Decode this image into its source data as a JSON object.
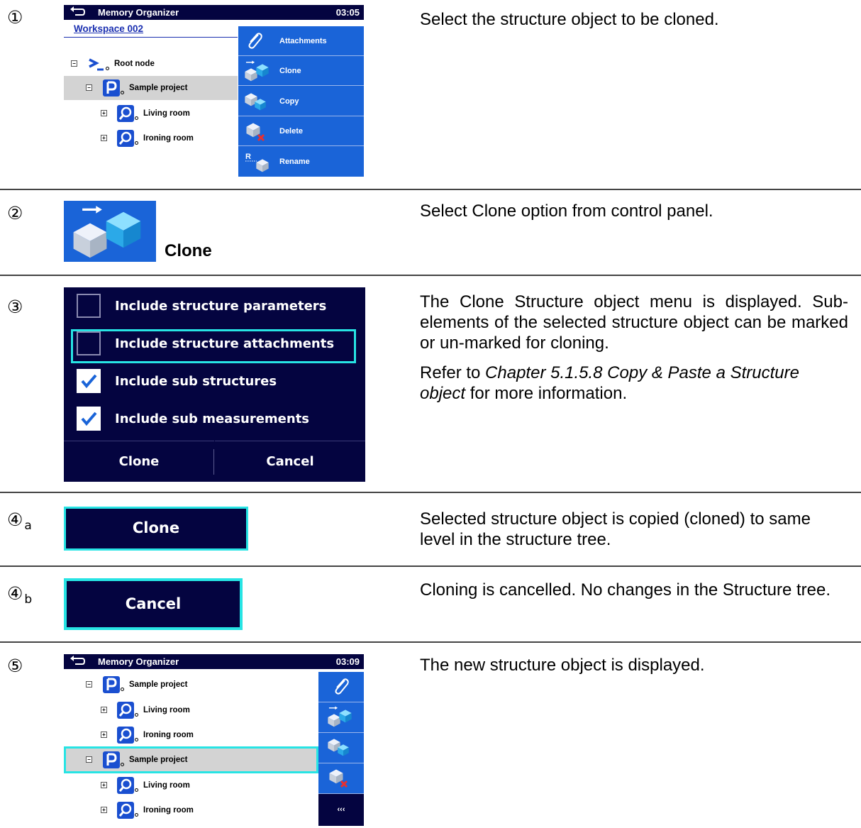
{
  "steps": [
    {
      "num": "①",
      "sub": ""
    },
    {
      "num": "②",
      "sub": ""
    },
    {
      "num": "③",
      "sub": ""
    },
    {
      "num": "④",
      "sub": "a"
    },
    {
      "num": "④",
      "sub": "b"
    },
    {
      "num": "⑤",
      "sub": ""
    }
  ],
  "descriptions": {
    "s1": "Select the structure object to be cloned.",
    "s2": "Select Clone option from control panel.",
    "s3_p1": "The Clone Structure object menu is displayed. Sub-elements of the selected structure object can be marked or un-marked for cloning.",
    "s3_p2_pre": "Refer to ",
    "s3_p2_ital": "Chapter 5.1.5.8 Copy & Paste a Structure object",
    "s3_p2_post": " for more information.",
    "s4a": "Selected structure object is copied (cloned) to same level in the structure tree.",
    "s4b": "Cloning is cancelled. No changes in the Structure tree.",
    "s5": "The new structure object is displayed."
  },
  "screen1": {
    "title": "Memory Organizer",
    "time": "03:05",
    "workspace": "Workspace 002",
    "tree": [
      {
        "label": "Root node",
        "expander": "−"
      },
      {
        "label": "Sample project",
        "expander": "−"
      },
      {
        "label": "Living room",
        "expander": "+"
      },
      {
        "label": "Ironing room",
        "expander": "+"
      }
    ],
    "panel": [
      "Attachments",
      "Clone",
      "Copy",
      "Delete",
      "Rename"
    ]
  },
  "clone_icon_label": "Clone",
  "dialog": {
    "options": [
      {
        "label": "Include structure parameters",
        "checked": false
      },
      {
        "label": "Include structure attachments",
        "checked": false
      },
      {
        "label": "Include sub structures",
        "checked": true
      },
      {
        "label": "Include sub measurements",
        "checked": true
      }
    ],
    "clone": "Clone",
    "cancel": "Cancel"
  },
  "btn_clone": "Clone",
  "btn_cancel": "Cancel",
  "screen5": {
    "title": "Memory Organizer",
    "time": "03:09",
    "tree": [
      {
        "label": "Sample project",
        "expander": "−"
      },
      {
        "label": "Living room",
        "expander": "+"
      },
      {
        "label": "Ironing room",
        "expander": "+"
      },
      {
        "label": "Sample project",
        "expander": "−"
      },
      {
        "label": "Living room",
        "expander": "+"
      },
      {
        "label": "Ironing room",
        "expander": "+"
      }
    ],
    "more": "‹‹‹"
  },
  "colors": {
    "accent": "#1a64d8",
    "header": "#040440",
    "highlight": "#27e4e4"
  }
}
